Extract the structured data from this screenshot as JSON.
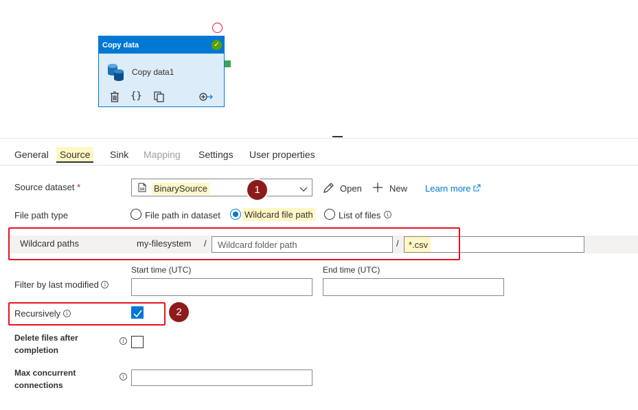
{
  "canvas": {
    "activity": {
      "header": "Copy data",
      "name": "Copy data1",
      "action_icons": [
        "delete-icon",
        "code-icon",
        "copy-icon",
        "add-output-icon"
      ],
      "header_color": "#0078d4",
      "status_color": "#57a300"
    }
  },
  "tabs": [
    {
      "label": "General",
      "active": false
    },
    {
      "label": "Source",
      "active": true
    },
    {
      "label": "Sink",
      "active": false
    },
    {
      "label": "Mapping",
      "active": false,
      "disabled": true
    },
    {
      "label": "Settings",
      "active": false
    },
    {
      "label": "User properties",
      "active": false
    }
  ],
  "source": {
    "dataset_label": "Source dataset",
    "required_mark": "*",
    "dataset_value": "BinarySource",
    "open_label": "Open",
    "new_label": "New",
    "learn_more": "Learn more",
    "file_path_type_label": "File path type",
    "file_path_options": [
      "File path in dataset",
      "Wildcard file path",
      "List of files"
    ],
    "file_path_selected": "Wildcard file path",
    "wildcard_label": "Wildcard paths",
    "container": "my-filesystem",
    "separator": "/",
    "folder_placeholder": "Wildcard folder path",
    "file_value": "*.csv",
    "filter_label": "Filter by last modified",
    "start_label": "Start time (UTC)",
    "end_label": "End time (UTC)",
    "recursive_label": "Recursively",
    "recursive_checked": true,
    "delete_label_1": "Delete files after",
    "delete_label_2": "completion",
    "delete_checked": false,
    "max_label_1": "Max concurrent",
    "max_label_2": "connections"
  },
  "annotations": [
    "1",
    "2"
  ],
  "colors": {
    "accent": "#0078d4",
    "highlight": "#fff8c5",
    "annotation_box": "#e81123",
    "badge": "#8e1b1b"
  }
}
